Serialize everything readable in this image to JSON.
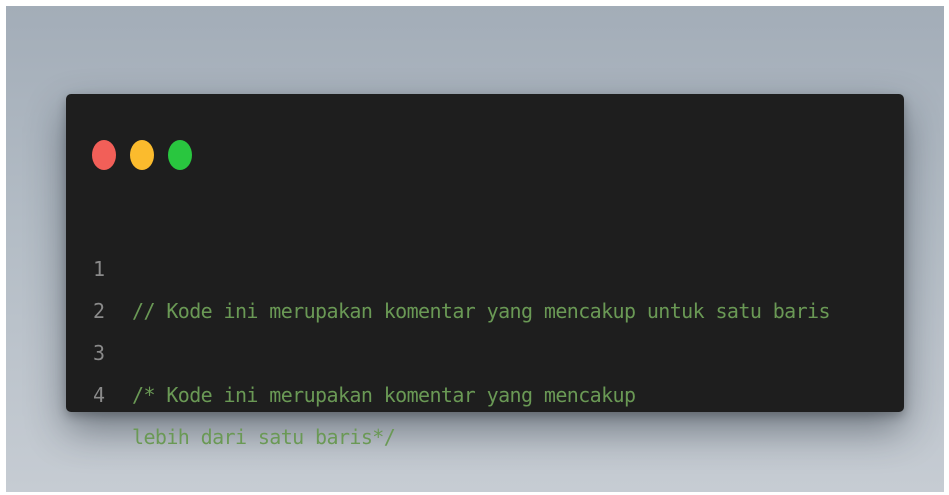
{
  "window": {
    "buttons": [
      {
        "name": "close",
        "color": "#f25f58"
      },
      {
        "name": "minimize",
        "color": "#fbbb2d"
      },
      {
        "name": "maximize",
        "color": "#29c63f"
      }
    ]
  },
  "code": {
    "comment_color": "#6a9955",
    "line_number_color": "#8a8a8a",
    "lines": [
      {
        "number": "1",
        "text": "// Kode ini merupakan komentar yang mencakup untuk satu baris"
      },
      {
        "number": "2",
        "text": ""
      },
      {
        "number": "3",
        "text": "/* Kode ini merupakan komentar yang mencakup"
      },
      {
        "number": "4",
        "text": "lebih dari satu baris*/"
      }
    ]
  }
}
